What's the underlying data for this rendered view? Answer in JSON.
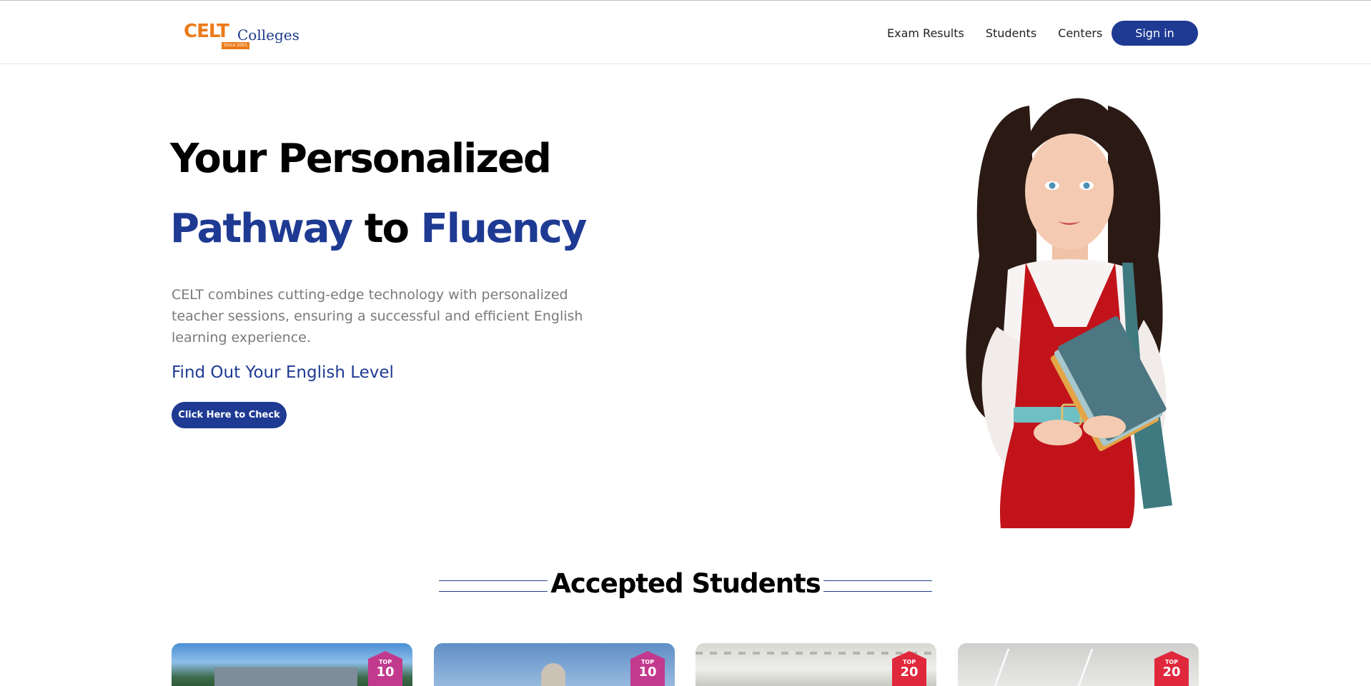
{
  "header": {
    "logo": {
      "brand": "CELT",
      "suffix": "Colleges",
      "since": "Since 2001"
    },
    "nav": [
      "Exam Results",
      "Students",
      "Centers"
    ],
    "signin_label": "Sign in"
  },
  "hero": {
    "title_line1": "Your Personalized",
    "title_word1": "Pathway",
    "title_word2": "to",
    "title_word3": "Fluency",
    "description": "CELT combines cutting-edge technology with personalized teacher sessions, ensuring a successful and efficient English learning experience.",
    "level_heading": "Find Out Your English Level",
    "check_button": "Click Here to Check"
  },
  "accepted": {
    "title": "Accepted Students",
    "cards": [
      {
        "badge_top": "TOP",
        "badge_rank": "10",
        "badge_color": "#c23a8e"
      },
      {
        "badge_top": "TOP",
        "badge_rank": "10",
        "badge_color": "#c23a8e"
      },
      {
        "badge_top": "TOP",
        "badge_rank": "20",
        "badge_color": "#e0283d"
      },
      {
        "badge_top": "TOP",
        "badge_rank": "20",
        "badge_color": "#e0283d"
      }
    ]
  },
  "colors": {
    "primary": "#1e3a93",
    "brand_orange": "#ec7a1a",
    "text_gray": "#7a7a7a"
  }
}
